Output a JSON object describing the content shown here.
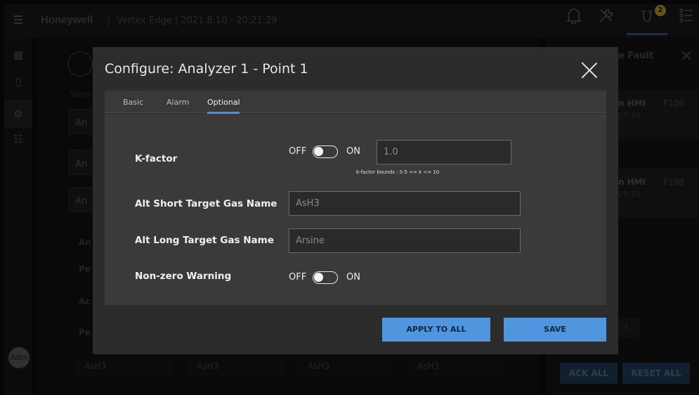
{
  "topbar": {
    "brand": "Honeywell",
    "app_title": "Vertex Edge | 2021.8.10 - 20:21:29",
    "badge_count": "2"
  },
  "leftnav": {
    "avatar": "Adm"
  },
  "background": {
    "breadcrumb": "Servi",
    "rows": [
      "An",
      "An",
      "An"
    ],
    "left_labels": [
      "An",
      "Pe",
      "Ac",
      "Pe"
    ],
    "bottom_cells": [
      "AsH3",
      "AsH3",
      "AsH3",
      "AsH3"
    ]
  },
  "right_panel": {
    "title": "e Fault",
    "cards": [
      {
        "source": "n HMI",
        "time": "23:19",
        "code": "F108"
      },
      {
        "source": "n HMI",
        "time": "23:19",
        "code": "F108"
      }
    ],
    "page": "1",
    "ack_all": "ACK ALL",
    "reset_all": "RESET ALL"
  },
  "modal": {
    "title": "Configure: Analyzer 1 - Point 1",
    "tabs": [
      "Basic",
      "Alarm",
      "Optional"
    ],
    "active_tab": "Optional",
    "kfactor": {
      "label": "K-factor",
      "off": "OFF",
      "on": "ON",
      "value": "1.0",
      "hint": "k-factor bounds : 0.5 <= k <= 10"
    },
    "alt_short": {
      "label": "Alt Short Target Gas Name",
      "value": "AsH3"
    },
    "alt_long": {
      "label": "Alt Long Target Gas Name",
      "value": "Arsine"
    },
    "nonzero": {
      "label": "Non-zero Warning",
      "off": "OFF",
      "on": "ON"
    },
    "apply_all": "APPLY TO ALL",
    "save": "SAVE"
  }
}
